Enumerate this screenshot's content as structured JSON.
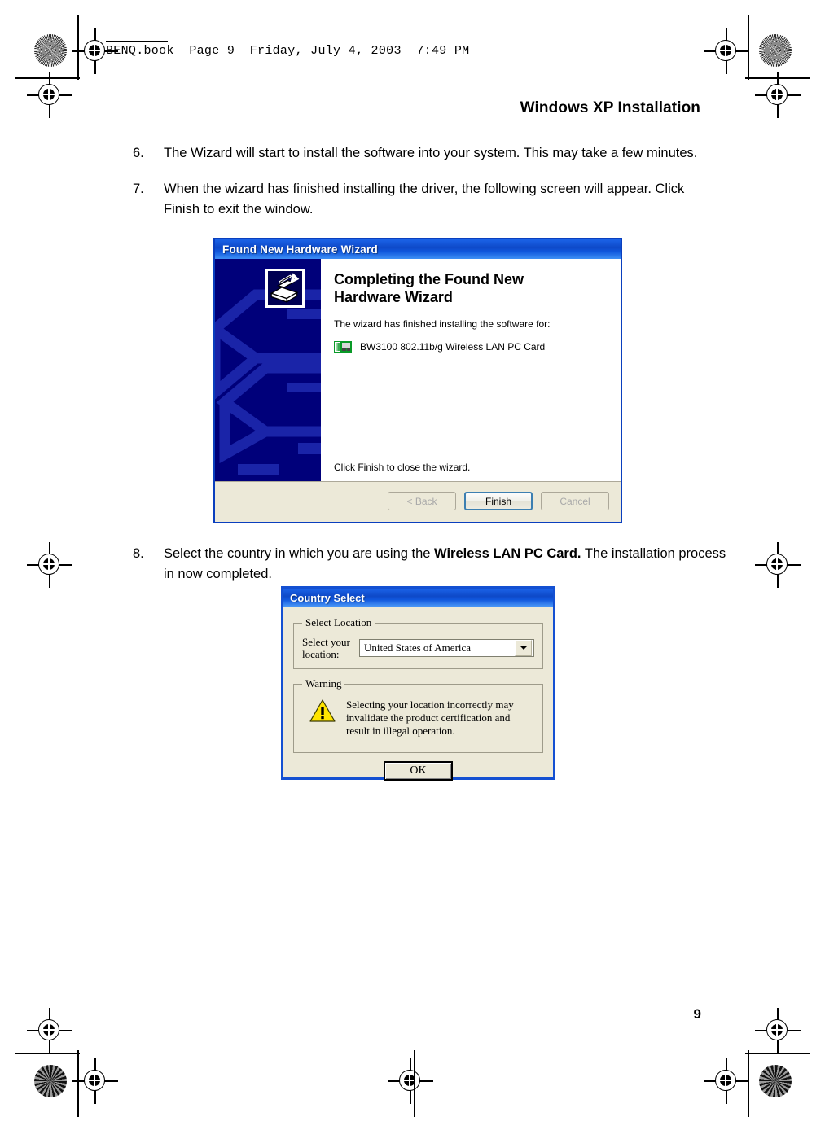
{
  "page": {
    "book_header": "BENQ.book  Page 9  Friday, July 4, 2003  7:49 PM",
    "running_title": "Windows XP Installation",
    "page_number": "9"
  },
  "steps": [
    {
      "number": "6.",
      "text": "The Wizard will start to install the software into your system. This may take a few minutes."
    },
    {
      "number": "7.",
      "text": "When the wizard has finished installing the driver, the following screen will appear. Click Finish to exit the window."
    }
  ],
  "step8": {
    "number": "8.",
    "text_before": "Select the country in which you are using the ",
    "text_bold": "Wireless LAN PC Card.",
    "text_after": " The installation process in now completed."
  },
  "wizard": {
    "title": "Found New Hardware Wizard",
    "heading": "Completing the Found New Hardware Wizard",
    "body_text": "The wizard has finished installing the software for:",
    "device_name": "BW3100 802.11b/g Wireless LAN PC Card",
    "device_icon": "pc-card-icon",
    "sidebar_icon": "hardware-wizard-icon",
    "footnote": "Click Finish to close the wizard.",
    "buttons": {
      "back": "< Back",
      "finish": "Finish",
      "cancel": "Cancel"
    },
    "colors": {
      "titlebar": "#0e49c8",
      "sidebar": "#00007a",
      "face": "#ece9d8",
      "border": "#0a3fbe"
    }
  },
  "country_select": {
    "title": "Country Select",
    "location_group_label": "Select Location",
    "location_field_label": "Select your location:",
    "location_value": "United States of America",
    "dropdown_icon": "chevron-down-icon",
    "warning_group_label": "Warning",
    "warning_icon": "warning-triangle-icon",
    "warning_text": "Selecting your location incorrectly may invalidate the product certification and result in illegal operation.",
    "ok_label": "OK",
    "colors": {
      "titlebar": "#1450d2",
      "face": "#ece9d8",
      "warning_yellow": "#ffe400"
    }
  },
  "print_marks": {
    "registration_icon": "registration-target-icon",
    "rosette_icon": "color-rosette-icon"
  }
}
